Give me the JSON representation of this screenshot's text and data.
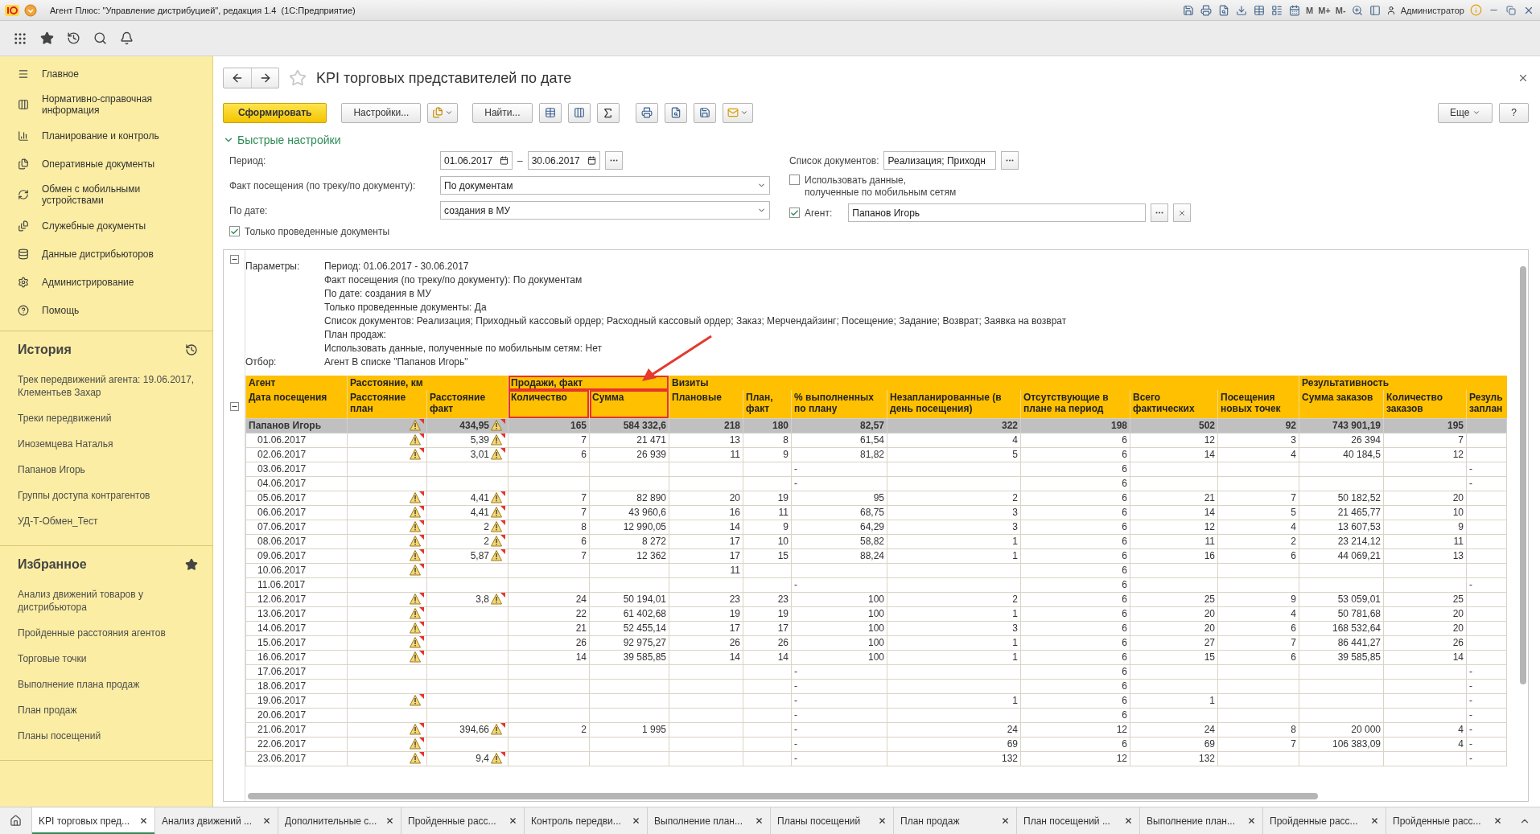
{
  "window": {
    "title": "Агент Плюс: \"Управление дистрибуцией\", редакция 1.4  (1С:Предприятие)",
    "memory_buttons": [
      "M",
      "M+",
      "M-"
    ],
    "user": "Администратор"
  },
  "sidebar": {
    "sections": [
      "Главное",
      "Нормативно-справочная информация",
      "Планирование и контроль",
      "Оперативные документы",
      "Обмен с мобильными устройствами",
      "Служебные документы",
      "Данные дистрибьюторов",
      "Администрирование",
      "Помощь"
    ],
    "history": {
      "title": "История",
      "items": [
        "Трек передвижений агента: 19.06.2017, Клементьев Захар",
        "Треки передвижений",
        "Иноземцева Наталья",
        "Папанов Игорь",
        "Группы доступа контрагентов",
        "УД-Т-Обмен_Тест"
      ]
    },
    "favorites": {
      "title": "Избранное",
      "items": [
        "Анализ движений товаров у дистрибьютора",
        "Пройденные расстояния агентов",
        "Торговые точки",
        "Выполнение плана продаж",
        "План продаж",
        "Планы посещений"
      ]
    }
  },
  "form": {
    "title": "KPI торговых представителей по дате",
    "toolbar": {
      "generate": "Сформировать",
      "settings": "Настройки...",
      "find": "Найти...",
      "more": "Еще",
      "help": "?"
    },
    "quick_settings": {
      "title": "Быстрые настройки",
      "expanded": true,
      "period": {
        "label": "Период:",
        "from": "01.06.2017",
        "separator": "–",
        "to": "30.06.2017"
      },
      "visit_fact": {
        "label": "Факт посещения (по треку/по документу):",
        "value": "По документам"
      },
      "by_date": {
        "label": "По дате:",
        "value": "создания в МУ"
      },
      "only_posted": {
        "label": "Только проведенные документы",
        "checked": true
      },
      "document_list": {
        "label": "Список документов:",
        "value": "Реализация; Приходн"
      },
      "use_mobile": {
        "label": "Использовать данные,\nполученные по мобильным сетям",
        "checked": false
      },
      "agent": {
        "label": "Агент:",
        "checked": true,
        "value": "Папанов Игорь"
      }
    }
  },
  "report": {
    "params": [
      {
        "label": "Параметры:",
        "lines": [
          "Период: 01.06.2017 - 30.06.2017",
          "Факт посещения (по треку/по документу): По документам",
          "По дате: создания в МУ",
          "Только проведенные документы: Да",
          "Список документов: Реализация; Приходный кассовый ордер; Расходный кассовый ордер; Заказ; Мерчендайзинг; Посещение; Задание; Возврат; Заявка на возврат",
          "План продаж:",
          "Использовать данные, полученные по мобильным сетям: Нет"
        ]
      },
      {
        "label": "Отбор:",
        "lines": [
          "Агент В списке \"Папанов Игорь\""
        ]
      }
    ],
    "groups": [
      {
        "label": "Агент",
        "highlighted": false
      },
      {
        "label": "Расстояние, км",
        "highlighted": false
      },
      {
        "label": "Продажи, факт",
        "highlighted": true
      },
      {
        "label": "Визиты",
        "highlighted": false
      },
      {
        "label": "Результативность",
        "highlighted": false
      }
    ],
    "columns": [
      "Дата посещения",
      "Расстояние план",
      "Расстояние факт",
      "Количество",
      "Сумма",
      "Плановые",
      "План, факт",
      "% выполненных по плану",
      "Незапланированные (в день посещения)",
      "Отсутствующие в плане на период",
      "Всего фактических",
      "Посещения новых точек",
      "Сумма заказов",
      "Количество заказов",
      "Резуль заплан"
    ],
    "rows": [
      {
        "kind": "total",
        "plan_warning": true,
        "fact_warning": true,
        "cells": [
          "Папанов Игорь",
          null,
          "434,95",
          "165",
          "584 332,6",
          "218",
          "180",
          "82,57",
          "322",
          "198",
          "502",
          "92",
          "743 901,19",
          "195",
          null
        ]
      },
      {
        "kind": "date",
        "plan_warning": true,
        "fact_warning": true,
        "cells": [
          "01.06.2017",
          null,
          "5,39",
          "7",
          "21 471",
          "13",
          "8",
          "61,54",
          "4",
          "6",
          "12",
          "3",
          "26 394",
          "7",
          null
        ]
      },
      {
        "kind": "date",
        "plan_warning": true,
        "fact_warning": true,
        "cells": [
          "02.06.2017",
          null,
          "3,01",
          "6",
          "26 939",
          "11",
          "9",
          "81,82",
          "5",
          "6",
          "14",
          "4",
          "40 184,5",
          "12",
          null
        ]
      },
      {
        "kind": "date",
        "plan_warning": false,
        "fact_warning": false,
        "cells": [
          "03.06.2017",
          null,
          null,
          null,
          null,
          null,
          null,
          "-",
          null,
          "6",
          null,
          null,
          null,
          null,
          "-"
        ]
      },
      {
        "kind": "date",
        "plan_warning": false,
        "fact_warning": false,
        "cells": [
          "04.06.2017",
          null,
          null,
          null,
          null,
          null,
          null,
          "-",
          null,
          "6",
          null,
          null,
          null,
          null,
          "-"
        ]
      },
      {
        "kind": "date",
        "plan_warning": true,
        "fact_warning": true,
        "cells": [
          "05.06.2017",
          null,
          "4,41",
          "7",
          "82 890",
          "20",
          "19",
          "95",
          "2",
          "6",
          "21",
          "7",
          "50 182,52",
          "20",
          null
        ]
      },
      {
        "kind": "date",
        "plan_warning": true,
        "fact_warning": true,
        "cells": [
          "06.06.2017",
          null,
          "4,41",
          "7",
          "43 960,6",
          "16",
          "11",
          "68,75",
          "3",
          "6",
          "14",
          "5",
          "21 465,77",
          "10",
          null
        ]
      },
      {
        "kind": "date",
        "plan_warning": true,
        "fact_warning": true,
        "cells": [
          "07.06.2017",
          null,
          "2",
          "8",
          "12 990,05",
          "14",
          "9",
          "64,29",
          "3",
          "6",
          "12",
          "4",
          "13 607,53",
          "9",
          null
        ]
      },
      {
        "kind": "date",
        "plan_warning": true,
        "fact_warning": true,
        "cells": [
          "08.06.2017",
          null,
          "2",
          "6",
          "8 272",
          "17",
          "10",
          "58,82",
          "1",
          "6",
          "11",
          "2",
          "23 214,12",
          "11",
          null
        ]
      },
      {
        "kind": "date",
        "plan_warning": true,
        "fact_warning": true,
        "cells": [
          "09.06.2017",
          null,
          "5,87",
          "7",
          "12 362",
          "17",
          "15",
          "88,24",
          "1",
          "6",
          "16",
          "6",
          "44 069,21",
          "13",
          null
        ]
      },
      {
        "kind": "date",
        "plan_warning": true,
        "fact_warning": false,
        "cells": [
          "10.06.2017",
          null,
          null,
          null,
          null,
          "11",
          null,
          null,
          null,
          "6",
          null,
          null,
          null,
          null,
          null
        ]
      },
      {
        "kind": "date",
        "plan_warning": false,
        "fact_warning": false,
        "cells": [
          "11.06.2017",
          null,
          null,
          null,
          null,
          null,
          null,
          "-",
          null,
          "6",
          null,
          null,
          null,
          null,
          "-"
        ]
      },
      {
        "kind": "date",
        "plan_warning": true,
        "fact_warning": true,
        "cells": [
          "12.06.2017",
          null,
          "3,8",
          "24",
          "50 194,01",
          "23",
          "23",
          "100",
          "2",
          "6",
          "25",
          "9",
          "53 059,01",
          "25",
          null
        ]
      },
      {
        "kind": "date",
        "plan_warning": true,
        "fact_warning": false,
        "cells": [
          "13.06.2017",
          null,
          null,
          "22",
          "61 402,68",
          "19",
          "19",
          "100",
          "1",
          "6",
          "20",
          "4",
          "50 781,68",
          "20",
          null
        ]
      },
      {
        "kind": "date",
        "plan_warning": true,
        "fact_warning": false,
        "cells": [
          "14.06.2017",
          null,
          null,
          "21",
          "52 455,14",
          "17",
          "17",
          "100",
          "3",
          "6",
          "20",
          "6",
          "168 532,64",
          "20",
          null
        ]
      },
      {
        "kind": "date",
        "plan_warning": true,
        "fact_warning": false,
        "cells": [
          "15.06.2017",
          null,
          null,
          "26",
          "92 975,27",
          "26",
          "26",
          "100",
          "1",
          "6",
          "27",
          "7",
          "86 441,27",
          "26",
          null
        ]
      },
      {
        "kind": "date",
        "plan_warning": true,
        "fact_warning": false,
        "cells": [
          "16.06.2017",
          null,
          null,
          "14",
          "39 585,85",
          "14",
          "14",
          "100",
          "1",
          "6",
          "15",
          "6",
          "39 585,85",
          "14",
          null
        ]
      },
      {
        "kind": "date",
        "plan_warning": false,
        "fact_warning": false,
        "cells": [
          "17.06.2017",
          null,
          null,
          null,
          null,
          null,
          null,
          "-",
          null,
          "6",
          null,
          null,
          null,
          null,
          "-"
        ]
      },
      {
        "kind": "date",
        "plan_warning": false,
        "fact_warning": false,
        "cells": [
          "18.06.2017",
          null,
          null,
          null,
          null,
          null,
          null,
          "-",
          null,
          "6",
          null,
          null,
          null,
          null,
          "-"
        ]
      },
      {
        "kind": "date",
        "plan_warning": true,
        "fact_warning": false,
        "cells": [
          "19.06.2017",
          null,
          null,
          null,
          null,
          null,
          null,
          "-",
          "1",
          "6",
          "1",
          null,
          null,
          null,
          "-"
        ]
      },
      {
        "kind": "date",
        "plan_warning": false,
        "fact_warning": false,
        "cells": [
          "20.06.2017",
          null,
          null,
          null,
          null,
          null,
          null,
          "-",
          null,
          "6",
          null,
          null,
          null,
          null,
          "-"
        ]
      },
      {
        "kind": "date",
        "plan_warning": true,
        "fact_warning": true,
        "cells": [
          "21.06.2017",
          null,
          "394,66",
          "2",
          "1 995",
          null,
          null,
          "-",
          "24",
          "12",
          "24",
          "8",
          "20 000",
          "4",
          "-"
        ]
      },
      {
        "kind": "date",
        "plan_warning": true,
        "fact_warning": false,
        "cells": [
          "22.06.2017",
          null,
          null,
          null,
          null,
          null,
          null,
          "-",
          "69",
          "6",
          "69",
          "7",
          "106 383,09",
          "4",
          "-"
        ]
      },
      {
        "kind": "date",
        "plan_warning": true,
        "fact_warning": true,
        "cells": [
          "23.06.2017",
          null,
          "9,4",
          null,
          null,
          null,
          null,
          "-",
          "132",
          "12",
          "132",
          null,
          null,
          null,
          "-"
        ]
      }
    ]
  },
  "tabs": [
    {
      "label": "KPI торговых пред...",
      "selected": true
    },
    {
      "label": "Анализ движений ...",
      "selected": false
    },
    {
      "label": "Дополнительные с...",
      "selected": false
    },
    {
      "label": "Пройденные расс...",
      "selected": false
    },
    {
      "label": "Контроль передви...",
      "selected": false
    },
    {
      "label": "Выполнение план...",
      "selected": false
    },
    {
      "label": "Планы посещений",
      "selected": false
    },
    {
      "label": "План продаж",
      "selected": false
    },
    {
      "label": "План посещений ...",
      "selected": false
    },
    {
      "label": "Выполнение план...",
      "selected": false
    },
    {
      "label": "Пройденные расс...",
      "selected": false
    },
    {
      "label": "Пройденные расс...",
      "selected": false
    }
  ]
}
